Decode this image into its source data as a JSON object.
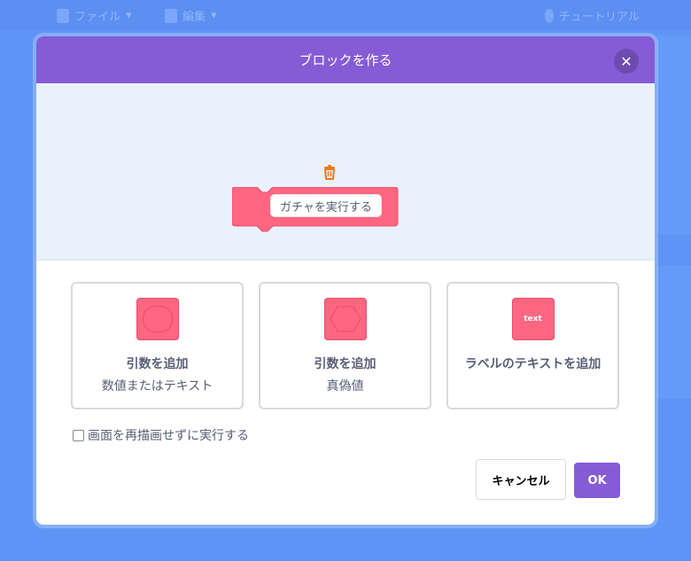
{
  "menubar": {
    "file_label": "ファイル",
    "edit_label": "編集",
    "tutorial_label": "チュートリアル"
  },
  "dialog": {
    "title": "ブロックを作る",
    "block_name": "ガチャを実行する",
    "options": [
      {
        "title": "引数を追加",
        "subtitle": "数値またはテキスト"
      },
      {
        "title": "引数を追加",
        "subtitle": "真偽値"
      },
      {
        "title": "ラベルのテキストを追加",
        "subtitle": "",
        "icon_text": "text"
      }
    ],
    "checkbox_label": "画面を再描画せずに実行する",
    "cancel_label": "キャンセル",
    "ok_label": "OK"
  },
  "colors": {
    "header": "#855cd6",
    "block": "#ff6680",
    "workspace": "#e9f1fc",
    "trash": "#f0781d"
  }
}
